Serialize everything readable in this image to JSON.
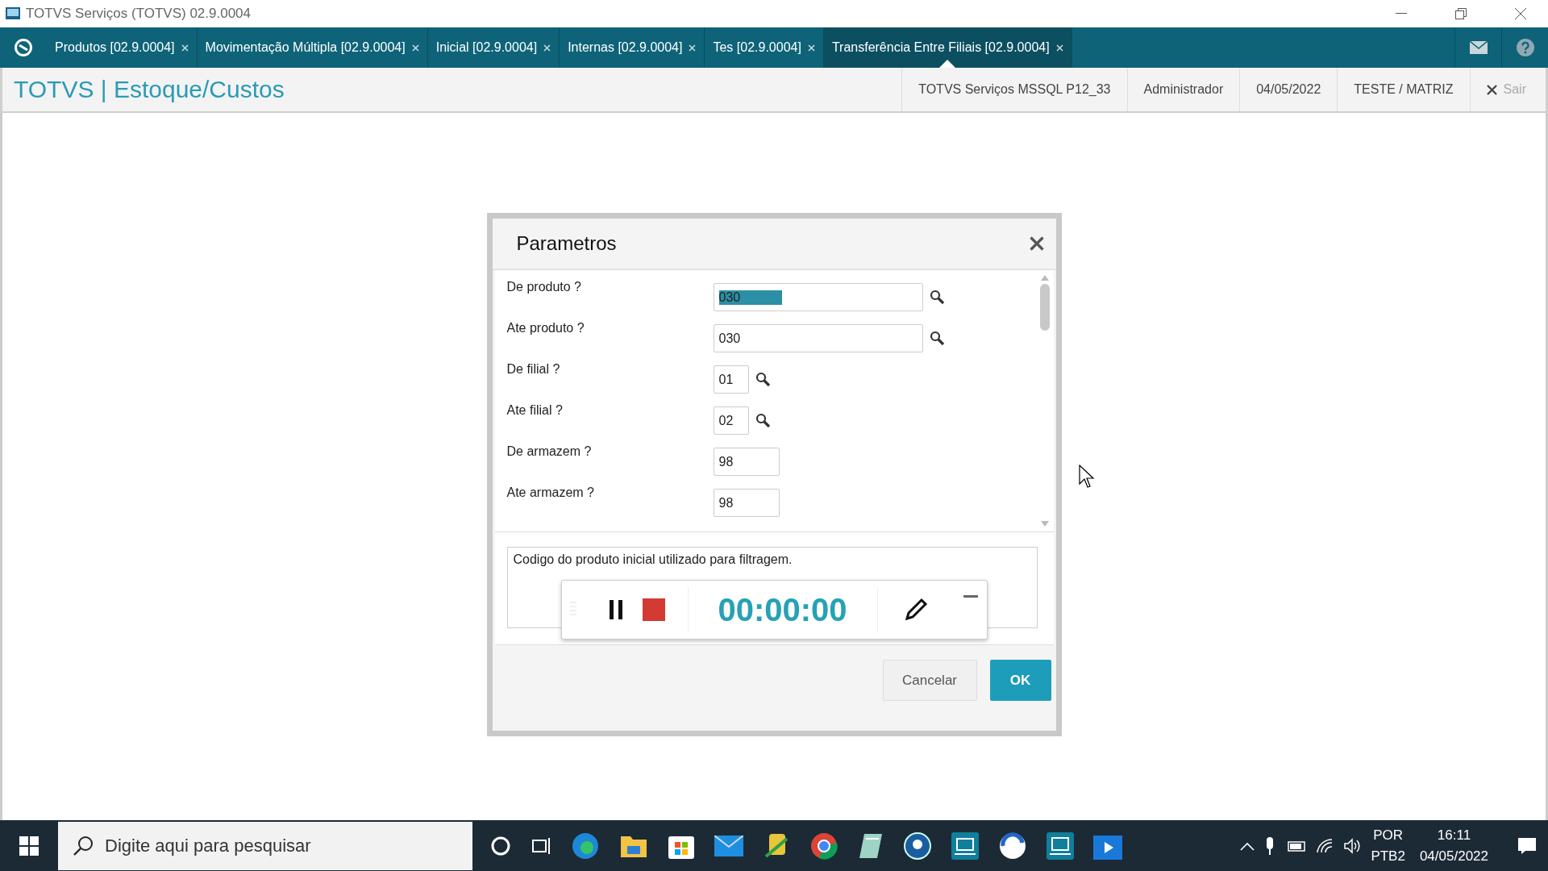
{
  "window": {
    "title": "TOTVS Serviços (TOTVS) 02.9.0004"
  },
  "tabs": [
    {
      "label": "Produtos [02.9.0004]",
      "selected": false
    },
    {
      "label": "Movimentação Múltipla [02.9.0004]",
      "selected": false
    },
    {
      "label": "Inicial [02.9.0004]",
      "selected": false
    },
    {
      "label": "Internas [02.9.0004]",
      "selected": false
    },
    {
      "label": "Tes [02.9.0004]",
      "selected": false
    },
    {
      "label": "Transferência Entre Filiais [02.9.0004]",
      "selected": true
    }
  ],
  "header": {
    "title": "TOTVS | Estoque/Custos",
    "info": [
      "TOTVS Serviços MSSQL P12_33",
      "Administrador",
      "04/05/2022",
      "TESTE / MATRIZ"
    ],
    "exit": "Sair"
  },
  "dialog": {
    "title": "Parametros",
    "fields": [
      {
        "label": "De  produto ?",
        "value": "030",
        "kind": "long",
        "lookup": true,
        "highlighted": true
      },
      {
        "label": "Ate produto ?",
        "value": "030",
        "kind": "long",
        "lookup": true,
        "highlighted": false
      },
      {
        "label": "De filial ?",
        "value": "01",
        "kind": "short",
        "lookup": true,
        "highlighted": false
      },
      {
        "label": "Ate filial ?",
        "value": "02",
        "kind": "short",
        "lookup": true,
        "highlighted": false
      },
      {
        "label": "De  armazem ?",
        "value": "98",
        "kind": "medium",
        "lookup": false,
        "highlighted": false
      },
      {
        "label": "Ate armazem ?",
        "value": "98",
        "kind": "medium",
        "lookup": false,
        "highlighted": false
      }
    ],
    "help": "Codigo do produto inicial utilizado para filtragem.",
    "recorder": {
      "time": "00:00:00"
    },
    "buttons": [
      {
        "label": "Cancelar",
        "kind": "secondary"
      },
      {
        "label": "OK",
        "kind": "primary"
      }
    ]
  },
  "taskbar": {
    "search_placeholder": "Digite aqui para pesquisar",
    "language": "POR",
    "layout": "PTB2",
    "time": "16:11",
    "date": "04/05/2022"
  }
}
